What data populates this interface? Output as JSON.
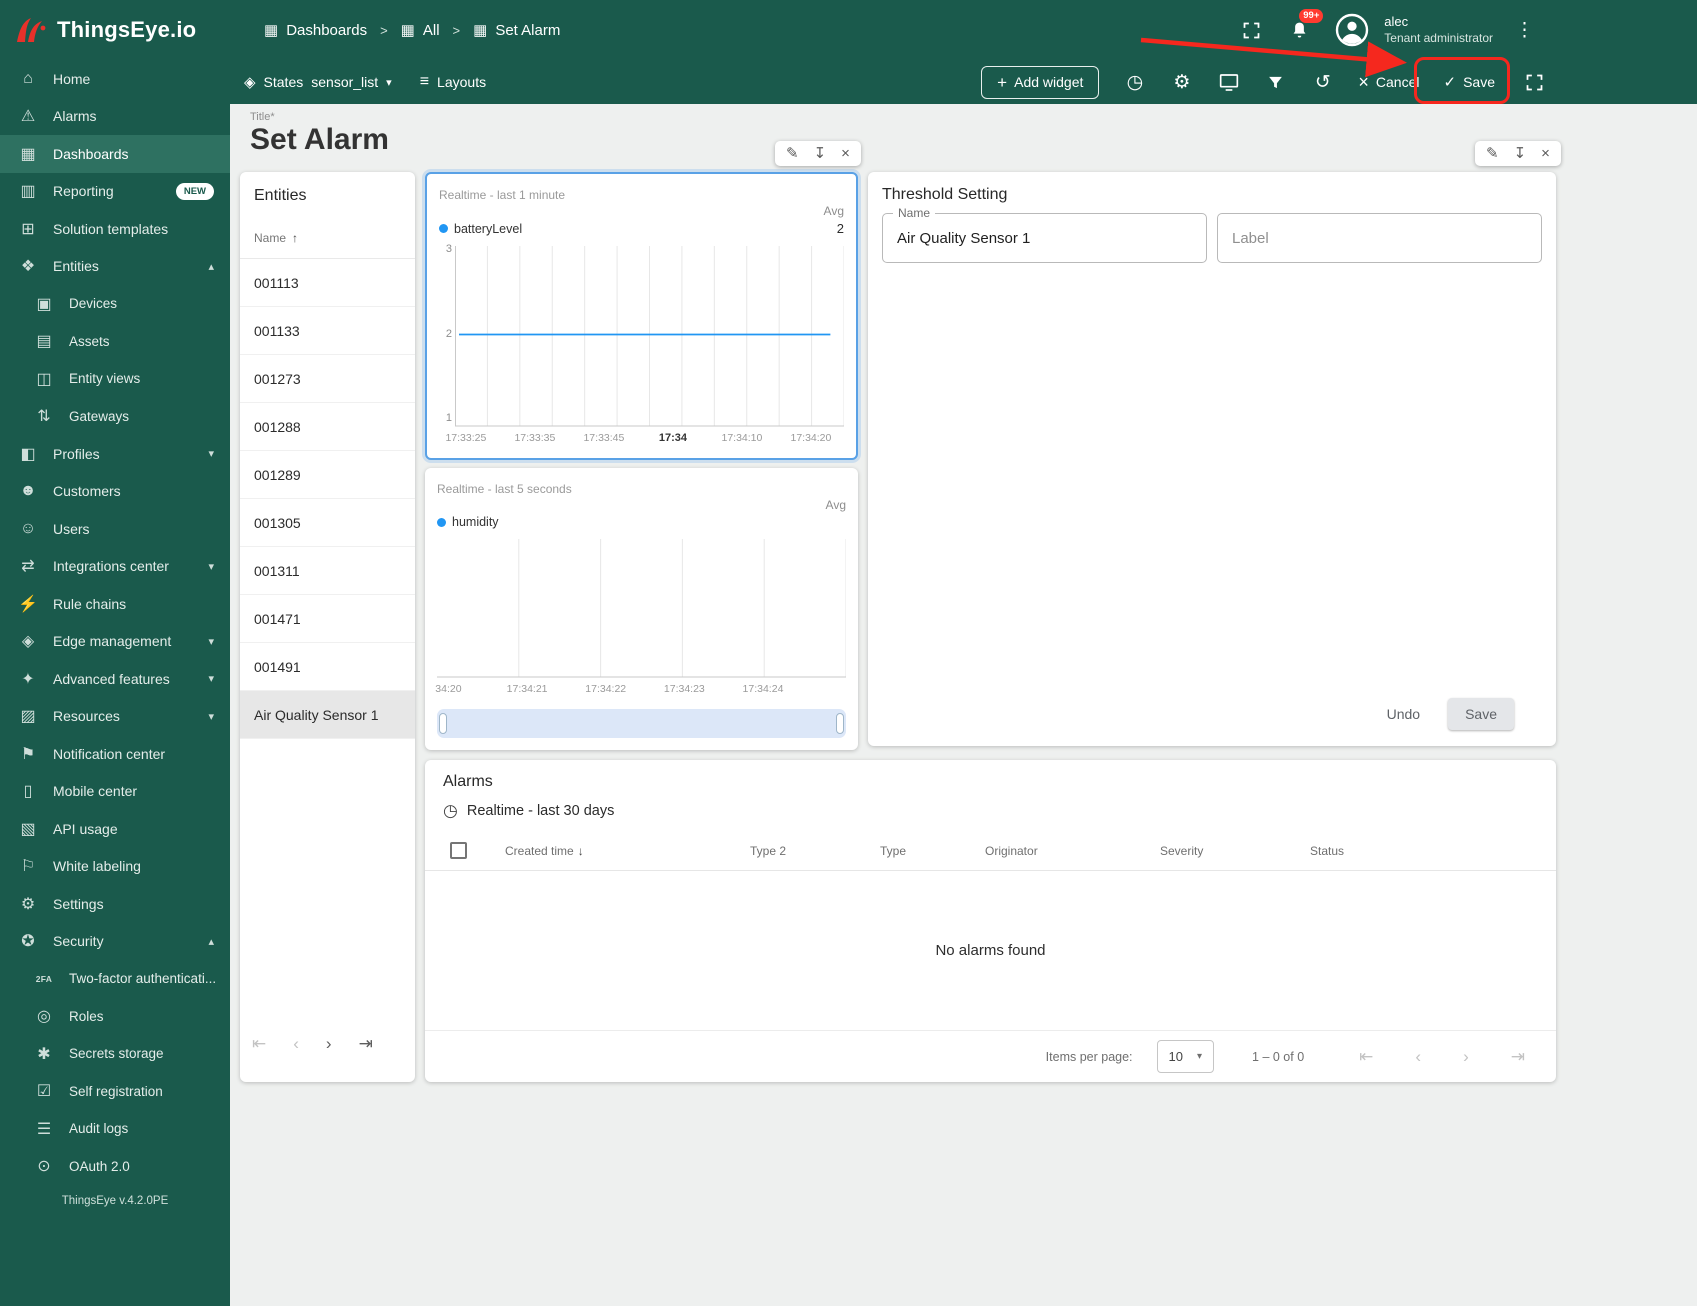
{
  "colors": {
    "primary_green": "#1a5a4c",
    "accent_red": "#e8312a",
    "chart_blue": "#2196f3",
    "annotation_red": "#f5281e"
  },
  "app": {
    "logo_text": "ThingsEye.io",
    "version": "ThingsEye v.4.2.0PE"
  },
  "header": {
    "breadcrumb": [
      "Dashboards",
      "All",
      "Set Alarm"
    ],
    "notification_badge": "99+",
    "user_name": "alec",
    "user_role": "Tenant administrator"
  },
  "toolbar": {
    "states": "States",
    "states_value": "sensor_list",
    "layouts": "Layouts",
    "add_widget": "Add widget",
    "cancel": "Cancel",
    "save": "Save"
  },
  "sidebar": {
    "items": [
      {
        "id": "home",
        "label": "Home",
        "icon": "home"
      },
      {
        "id": "alarms",
        "label": "Alarms",
        "icon": "warning"
      },
      {
        "id": "dashboards",
        "label": "Dashboards",
        "icon": "grid",
        "active": true
      },
      {
        "id": "reporting",
        "label": "Reporting",
        "icon": "report",
        "badge": "NEW"
      },
      {
        "id": "solution-templates",
        "label": "Solution templates",
        "icon": "apps"
      },
      {
        "id": "entities",
        "label": "Entities",
        "icon": "category",
        "chevron": "up"
      },
      {
        "id": "devices",
        "label": "Devices",
        "icon": "devices",
        "indent": true
      },
      {
        "id": "assets",
        "label": "Assets",
        "icon": "assets",
        "indent": true
      },
      {
        "id": "entity-views",
        "label": "Entity views",
        "icon": "view",
        "indent": true
      },
      {
        "id": "gateways",
        "label": "Gateways",
        "icon": "gateway",
        "indent": true
      },
      {
        "id": "profiles",
        "label": "Profiles",
        "icon": "profiles",
        "chevron": "down"
      },
      {
        "id": "customers",
        "label": "Customers",
        "icon": "people"
      },
      {
        "id": "users",
        "label": "Users",
        "icon": "person"
      },
      {
        "id": "integrations-center",
        "label": "Integrations center",
        "icon": "integration",
        "chevron": "down"
      },
      {
        "id": "rule-chains",
        "label": "Rule chains",
        "icon": "rule-chain"
      },
      {
        "id": "edge-management",
        "label": "Edge management",
        "icon": "edge",
        "chevron": "down"
      },
      {
        "id": "advanced-features",
        "label": "Advanced features",
        "icon": "advanced",
        "chevron": "down"
      },
      {
        "id": "resources",
        "label": "Resources",
        "icon": "folder",
        "chevron": "down"
      },
      {
        "id": "notification-center",
        "label": "Notification center",
        "icon": "flag"
      },
      {
        "id": "mobile-center",
        "label": "Mobile center",
        "icon": "mobile"
      },
      {
        "id": "api-usage",
        "label": "API usage",
        "icon": "api"
      },
      {
        "id": "white-labeling",
        "label": "White labeling",
        "icon": "label"
      },
      {
        "id": "settings",
        "label": "Settings",
        "icon": "gear"
      },
      {
        "id": "security",
        "label": "Security",
        "icon": "shield",
        "chevron": "up"
      },
      {
        "id": "two-factor-authentication",
        "label": "Two-factor authenticati...",
        "icon": "2fa",
        "indent": true
      },
      {
        "id": "roles",
        "label": "Roles",
        "icon": "role",
        "indent": true
      },
      {
        "id": "secrets-storage",
        "label": "Secrets storage",
        "icon": "key",
        "indent": true
      },
      {
        "id": "self-registration",
        "label": "Self registration",
        "icon": "person-add",
        "indent": true
      },
      {
        "id": "audit-logs",
        "label": "Audit logs",
        "icon": "list",
        "indent": true
      },
      {
        "id": "oauth-2",
        "label": "OAuth 2.0",
        "icon": "oauth",
        "indent": true
      }
    ]
  },
  "page": {
    "title_label": "Title*",
    "title": "Set Alarm"
  },
  "entities_widget": {
    "title": "Entities",
    "column": "Name",
    "rows": [
      "001113",
      "001133",
      "001273",
      "001288",
      "001289",
      "001305",
      "001311",
      "001471",
      "001491",
      "Air Quality Sensor 1"
    ],
    "selected_row": "Air Quality Sensor 1"
  },
  "threshold_widget": {
    "title": "Threshold Setting",
    "name_label": "Name",
    "name_value": "Air Quality Sensor 1",
    "label_placeholder": "Label",
    "undo": "Undo",
    "save": "Save"
  },
  "alarms_widget": {
    "title": "Alarms",
    "timewindow": "Realtime - last 30 days",
    "columns": [
      "Created time",
      "Type 2",
      "Type",
      "Originator",
      "Severity",
      "Status"
    ],
    "empty": "No alarms found",
    "items_per_page_label": "Items per page:",
    "items_per_page": "10",
    "range": "1 – 0 of 0"
  },
  "chart_data": [
    {
      "type": "line",
      "title": "Realtime - last 1 minute",
      "legend_header": "Avg",
      "series": [
        {
          "name": "batteryLevel",
          "color": "#2196f3",
          "avg": 2,
          "constant_value": 2
        }
      ],
      "x_ticks": [
        "17:33:25",
        "17:33:35",
        "17:33:45",
        "17:34",
        "17:34:10",
        "17:34:20"
      ],
      "major_tick": "17:34",
      "y_ticks": [
        3,
        2,
        1
      ],
      "ylim": [
        1,
        3
      ],
      "gridlines": 12,
      "legend_position": "top"
    },
    {
      "type": "line",
      "title": "Realtime - last 5 seconds",
      "legend_header": "Avg",
      "series": [
        {
          "name": "humidity",
          "color": "#2196f3",
          "avg": null,
          "values": []
        }
      ],
      "x_ticks": [
        "34:20",
        "17:34:21",
        "17:34:22",
        "17:34:23",
        "17:34:24"
      ],
      "major_tick": null,
      "y_ticks": null,
      "ylim": null,
      "gridlines": 5,
      "legend_position": "top"
    }
  ]
}
